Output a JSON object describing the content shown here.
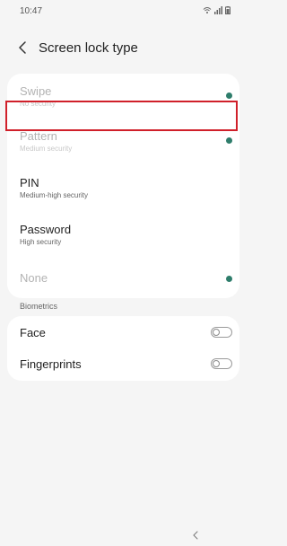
{
  "status_bar": {
    "time": "10:47",
    "icons": [
      "wifi-icon",
      "signal-icon",
      "battery-icon"
    ]
  },
  "app_bar": {
    "back_icon": "chevron-left-icon",
    "title": "Screen lock type"
  },
  "lock_options": [
    {
      "label": "Swipe",
      "subtitle": "No security",
      "enabled": false,
      "indicator": true
    },
    {
      "label": "Pattern",
      "subtitle": "Medium security",
      "enabled": false,
      "indicator": true
    },
    {
      "label": "PIN",
      "subtitle": "Medium-high security",
      "enabled": true,
      "indicator": false,
      "highlighted": true
    },
    {
      "label": "Password",
      "subtitle": "High security",
      "enabled": true,
      "indicator": false
    },
    {
      "label": "None",
      "subtitle": "",
      "enabled": false,
      "indicator": true
    }
  ],
  "biometrics": {
    "section_label": "Biometrics",
    "items": [
      {
        "label": "Face",
        "toggle_on": false
      },
      {
        "label": "Fingerprints",
        "toggle_on": false
      }
    ]
  },
  "nav_bar": {
    "back_icon": "nav-back-icon"
  },
  "colors": {
    "background": "#f5f5f5",
    "card": "#ffffff",
    "indicator": "#2e7d6b",
    "highlight": "#d0202a"
  }
}
